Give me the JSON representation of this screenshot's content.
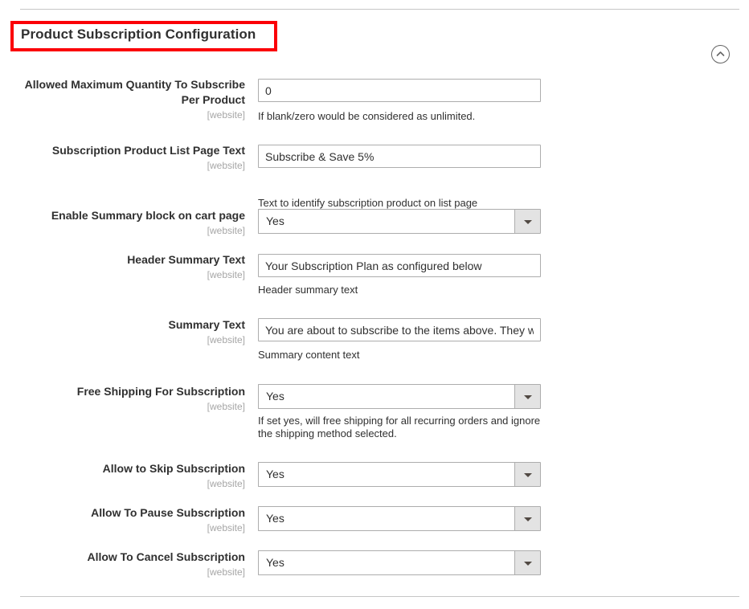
{
  "section": {
    "title": "Product Subscription Configuration",
    "collapse_icon": "chevron-up-circle-icon",
    "highlight_color": "#fb0007",
    "scope_label": "[website]"
  },
  "fields": [
    {
      "label": "Allowed Maximum Quantity To Subscribe Per Product",
      "scope": "[website]",
      "type": "text",
      "value": "0",
      "placeholder": "",
      "comment": "If blank/zero would be considered as unlimited."
    },
    {
      "label": "Subscription Product List Page Text",
      "scope": "[website]",
      "type": "text",
      "value": "Subscribe & Save 5%",
      "placeholder": "",
      "comment": "Text to identify subscription product on list page"
    },
    {
      "label": "Enable Summary block on cart page",
      "scope": "[website]",
      "type": "select",
      "value": "Yes",
      "comment": ""
    },
    {
      "label": "Header Summary Text",
      "scope": "[website]",
      "type": "text",
      "value": "Your Subscription Plan as configured below",
      "placeholder": "",
      "comment": "Header summary text"
    },
    {
      "label": "Summary Text",
      "scope": "[website]",
      "type": "text",
      "value": "You are about to subscribe to the items above. They will be",
      "placeholder": "",
      "comment": "Summary content text"
    },
    {
      "label": "Free Shipping For Subscription",
      "scope": "[website]",
      "type": "select",
      "value": "Yes",
      "comment": "If set yes, will free shipping for all recurring orders and ignore the shipping method selected."
    },
    {
      "label": "Allow to Skip Subscription",
      "scope": "[website]",
      "type": "select",
      "value": "Yes",
      "comment": ""
    },
    {
      "label": "Allow To Pause Subscription",
      "scope": "[website]",
      "type": "select",
      "value": "Yes",
      "comment": ""
    },
    {
      "label": "Allow To Cancel Subscription",
      "scope": "[website]",
      "type": "select",
      "value": "Yes",
      "comment": ""
    }
  ]
}
